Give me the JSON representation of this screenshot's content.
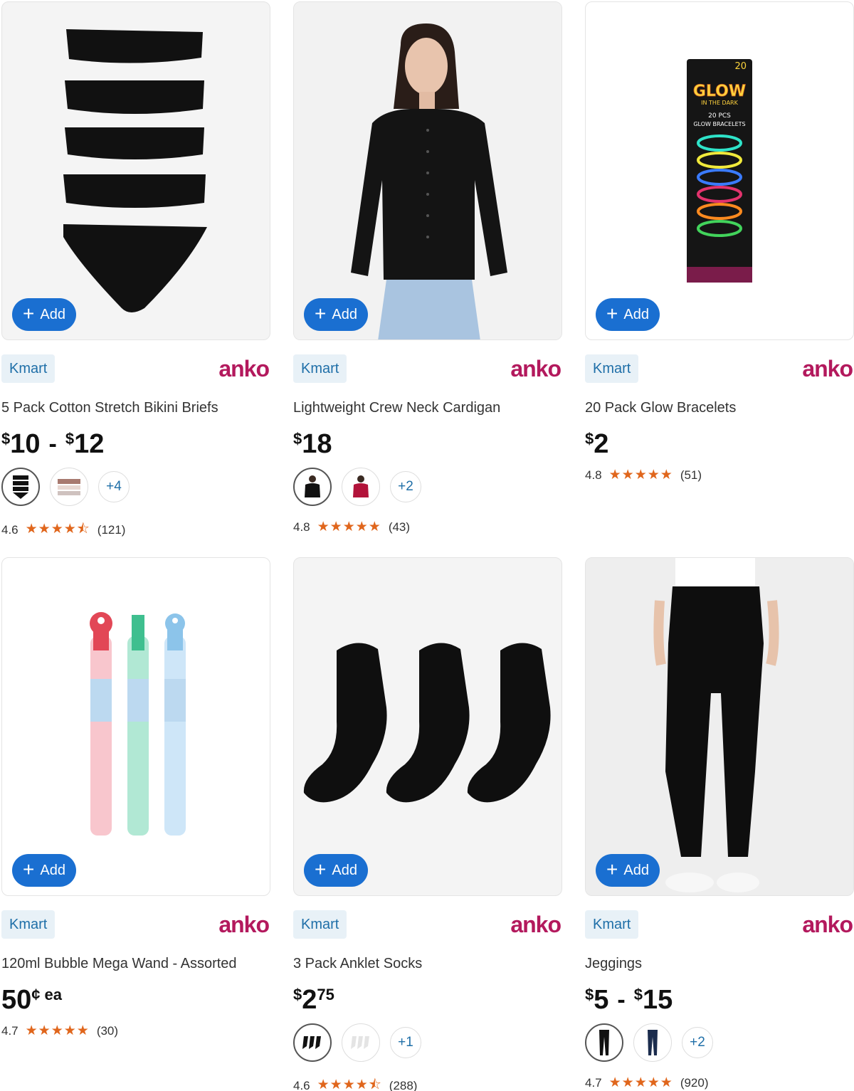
{
  "colors": {
    "accent": "#1a6fd1",
    "kmart_tag_bg": "#e8f1f7",
    "kmart_tag_text": "#1f6fa8",
    "anko_brand": "#b3195d",
    "star": "#e0661c"
  },
  "products": [
    {
      "add_label": "Add",
      "store_tag": "Kmart",
      "brand": "anko",
      "title": "5 Pack Cotton Stretch Bikini Briefs",
      "price": {
        "currency": "$",
        "from": "10",
        "to_currency": "$",
        "to": "12",
        "separator": "-"
      },
      "more_colours": "+4",
      "rating": {
        "score": "4.6",
        "stars": "★★★★⯪",
        "count": "(121)"
      }
    },
    {
      "add_label": "Add",
      "store_tag": "Kmart",
      "brand": "anko",
      "title": "Lightweight Crew Neck Cardigan",
      "price": {
        "currency": "$",
        "amount": "18"
      },
      "more_colours": "+2",
      "rating": {
        "score": "4.8",
        "stars": "★★★★★",
        "count": "(43)"
      }
    },
    {
      "add_label": "Add",
      "store_tag": "Kmart",
      "brand": "anko",
      "title": "20 Pack Glow Bracelets",
      "price": {
        "currency": "$",
        "amount": "2"
      },
      "rating": {
        "score": "4.8",
        "stars": "★★★★★",
        "count": "(51)"
      },
      "package_text": {
        "glow": "GLOW",
        "in_the_dark": "IN THE DARK",
        "pcs": "20 PCS",
        "bracelets": "GLOW BRACELETS",
        "count": "20"
      }
    },
    {
      "add_label": "Add",
      "store_tag": "Kmart",
      "brand": "anko",
      "title": "120ml Bubble Mega Wand - Assorted",
      "price": {
        "amount": "50",
        "unit": "¢",
        "suffix": "ea"
      },
      "rating": {
        "score": "4.7",
        "stars": "★★★★★",
        "count": "(30)"
      }
    },
    {
      "add_label": "Add",
      "store_tag": "Kmart",
      "brand": "anko",
      "title": "3 Pack Anklet Socks",
      "price": {
        "currency": "$",
        "amount": "2",
        "cents": "75"
      },
      "more_colours": "+1",
      "rating": {
        "score": "4.6",
        "stars": "★★★★⯪",
        "count": "(288)"
      }
    },
    {
      "add_label": "Add",
      "store_tag": "Kmart",
      "brand": "anko",
      "title": "Jeggings",
      "price": {
        "currency": "$",
        "from": "5",
        "to_currency": "$",
        "to": "15",
        "separator": "-"
      },
      "more_colours": "+2",
      "rating": {
        "score": "4.7",
        "stars": "★★★★★",
        "count": "(920)"
      }
    }
  ]
}
